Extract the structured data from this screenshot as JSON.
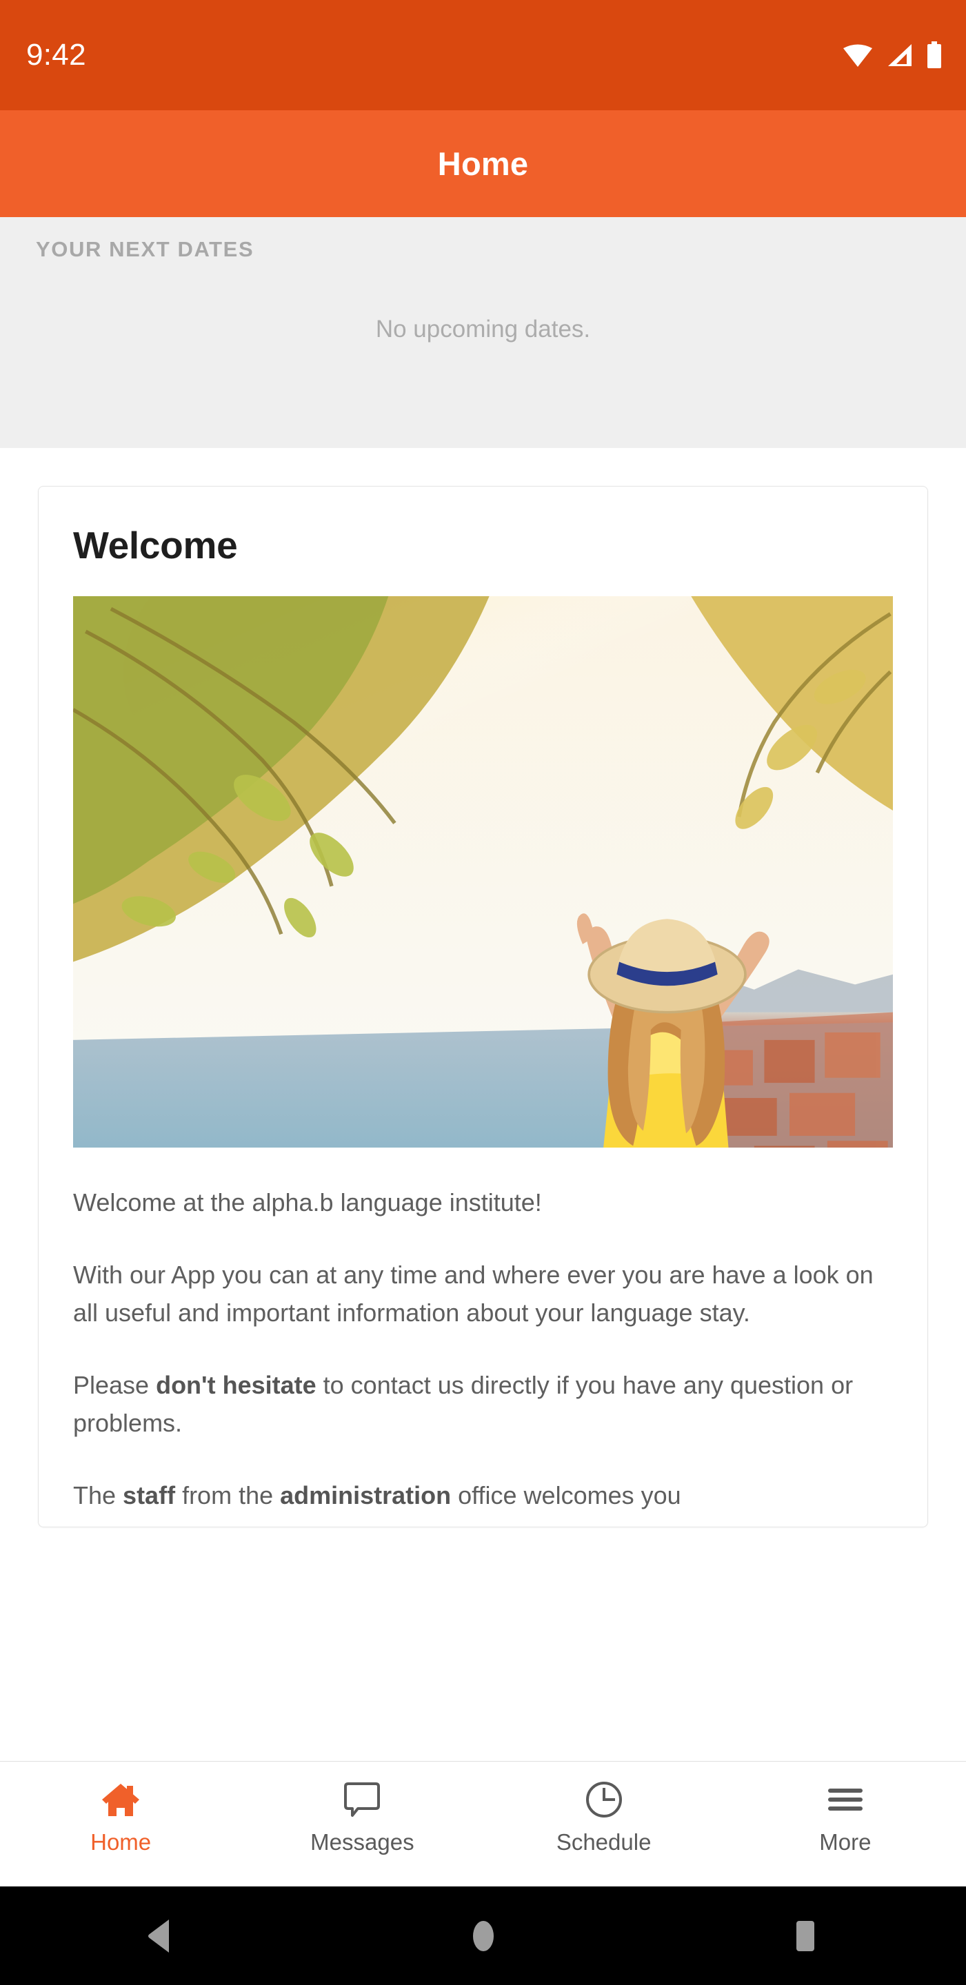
{
  "status_bar": {
    "time": "9:42",
    "icons": [
      "wifi-icon",
      "cellular-signal-icon",
      "battery-icon"
    ],
    "background": "#D9480F"
  },
  "app_bar": {
    "title": "Home",
    "background": "#F0602A"
  },
  "next_dates": {
    "section_label": "YOUR NEXT DATES",
    "empty_message": "No upcoming dates.",
    "background": "#EFEFEF"
  },
  "card": {
    "title": "Welcome",
    "image": {
      "name": "welcome-hero-image",
      "alt": "Woman with straw hat raising arms on a stone balcony overlooking a turquoise bay and a red-roofed coastal city"
    },
    "paragraphs": [
      {
        "id": "p1",
        "runs": [
          {
            "text": "Welcome at the alpha.b language institute!",
            "bold": false
          }
        ]
      },
      {
        "id": "p2",
        "runs": [
          {
            "text": "With our App you can at any time and where ever you are have a look on all useful and important information about your language stay.",
            "bold": false
          }
        ]
      },
      {
        "id": "p3",
        "runs": [
          {
            "text": "Please ",
            "bold": false
          },
          {
            "text": "don't hesitate",
            "bold": true
          },
          {
            "text": " to contact us directly if you have any question or problems.",
            "bold": false
          }
        ]
      },
      {
        "id": "p4",
        "runs": [
          {
            "text": "The ",
            "bold": false
          },
          {
            "text": "staff",
            "bold": true
          },
          {
            "text": " from the ",
            "bold": false
          },
          {
            "text": "administration",
            "bold": true
          },
          {
            "text": " office welcomes you",
            "bold": false
          }
        ]
      }
    ]
  },
  "tab_bar": {
    "active_color": "#F0602A",
    "inactive_color": "#5A5A5A",
    "items": [
      {
        "label": "Home",
        "icon": "home-icon",
        "active": true
      },
      {
        "label": "Messages",
        "icon": "message-bubble-icon",
        "active": false
      },
      {
        "label": "Schedule",
        "icon": "clock-icon",
        "active": false
      },
      {
        "label": "More",
        "icon": "hamburger-menu-icon",
        "active": false
      }
    ]
  },
  "android_nav": {
    "buttons": [
      {
        "name": "back-button",
        "icon": "triangle-back-icon"
      },
      {
        "name": "home-button",
        "icon": "circle-home-icon"
      },
      {
        "name": "recents-button",
        "icon": "square-recents-icon"
      }
    ]
  }
}
